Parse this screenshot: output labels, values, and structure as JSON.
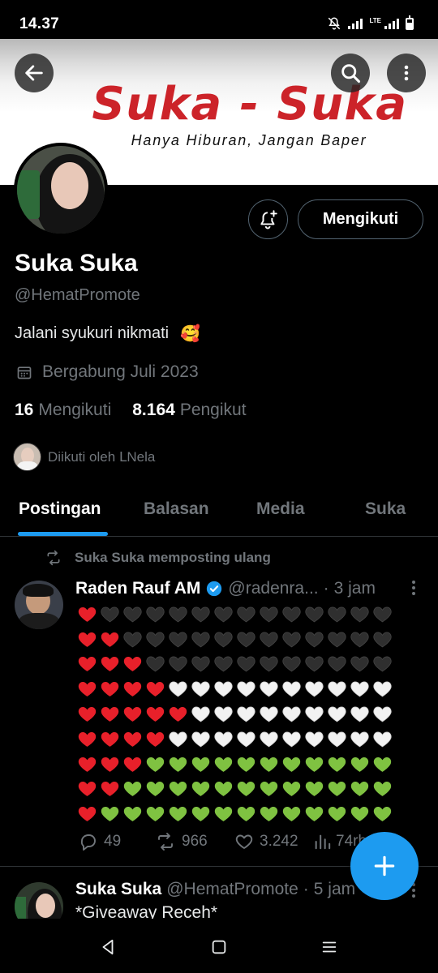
{
  "status_bar": {
    "time": "14.37",
    "network": "LTE",
    "icons": [
      "mute-icon",
      "signal-icon",
      "battery-icon"
    ]
  },
  "banner": {
    "title": "Suka - Suka",
    "subtitle": "Hanya Hiburan, Jangan Baper",
    "title_color": "#cc2329"
  },
  "toolbar": {
    "back_icon": "arrow-left-icon",
    "search_icon": "search-icon",
    "more_icon": "more-vertical-icon"
  },
  "profile": {
    "name": "Suka Suka",
    "handle": "@HematPromote",
    "bio": "Jalani syukuri nikmati",
    "bio_emoji": "🥰",
    "joined": "Bergabung Juli 2023",
    "following_count": "16",
    "following_label": "Mengikuti",
    "followers_count": "8.164",
    "followers_label": "Pengikut",
    "followed_by": "Diikuti oleh ᒪNela",
    "follow_button": "Mengikuti"
  },
  "tabs": [
    {
      "label": "Postingan",
      "active": true
    },
    {
      "label": "Balasan",
      "active": false
    },
    {
      "label": "Media",
      "active": false
    },
    {
      "label": "Suka",
      "active": false
    }
  ],
  "feed": [
    {
      "repost_label": "Suka Suka memposting ulang",
      "author": "Raden Rauf AM",
      "verified": true,
      "handle": "@radenra...",
      "dot": "·",
      "time": "3 jam",
      "heart_rows": [
        "RBBBBBBBBBBBBB",
        "RRBBBBBBBBBBBB",
        "RRRBBBBBBBBBBB",
        "RRRRWWWWWWWWWW",
        "RRRRRWWWWWWWWW",
        "RRRRWWWWWWWWWW",
        "RRRGGGGGGGGGGG",
        "RRGGGGGGGGGGGG",
        "RGGGGGGGGGGGGG"
      ],
      "replies": "49",
      "reposts": "966",
      "likes": "3.242",
      "views": "74rb"
    },
    {
      "author": "Suka Suka",
      "handle": "@HematPromote",
      "dot": "·",
      "time": "5 jam",
      "text": "*Giveaway Receh*"
    }
  ],
  "colors": {
    "accent": "#1d9bf0",
    "muted": "#71767b",
    "border": "#2f3336",
    "heart_red": "#e8202a",
    "heart_black": "#2f2f2f",
    "heart_white": "#f2f2f2",
    "heart_green": "#7fc241"
  }
}
